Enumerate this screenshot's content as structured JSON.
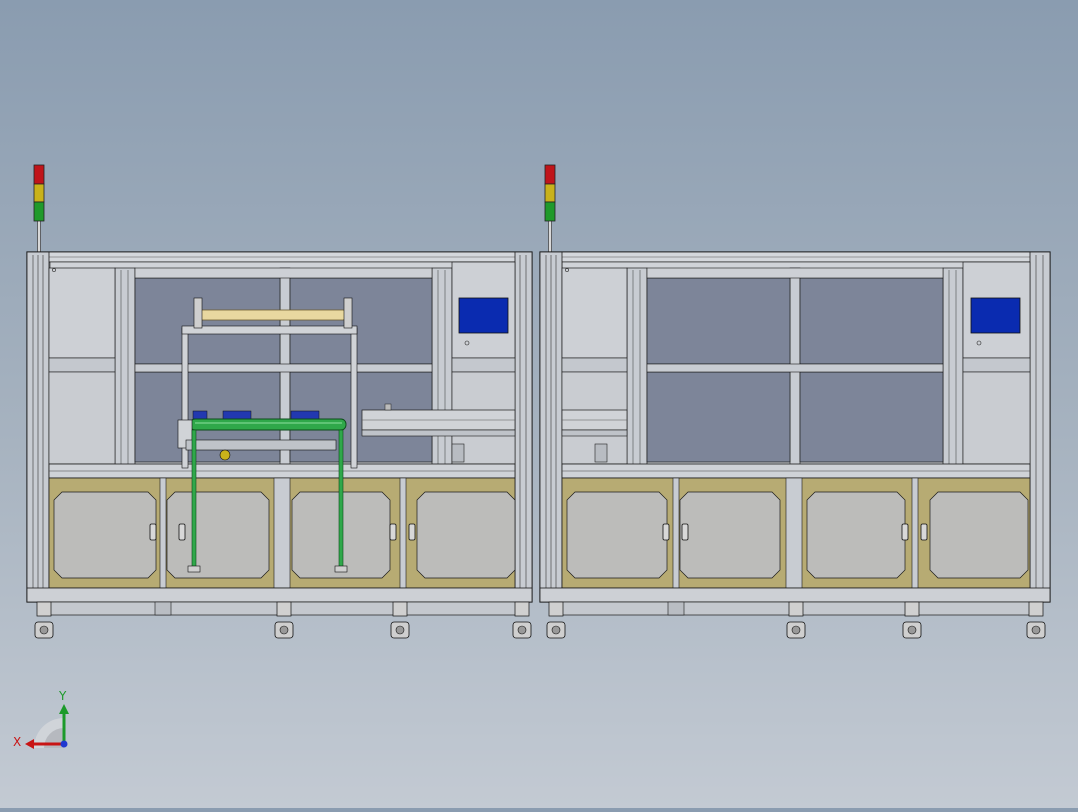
{
  "triad": {
    "x_label": "X",
    "y_label": "Y"
  },
  "colors": {
    "frame": "#c8ccd2",
    "frame_dark": "#1a1a1a",
    "door_panel": "#b7ab73",
    "glass": "#7d8599",
    "hmi_screen": "#0a2bb0",
    "lamp_red": "#c0141a",
    "lamp_yellow": "#c9b21a",
    "lamp_green": "#1f9a2a",
    "roller_green": "#2fa84a",
    "roller_gold": "#e8d8a0"
  },
  "machines": [
    {
      "id": "machine-left",
      "has_roller_module": true
    },
    {
      "id": "machine-right",
      "has_roller_module": false
    }
  ]
}
